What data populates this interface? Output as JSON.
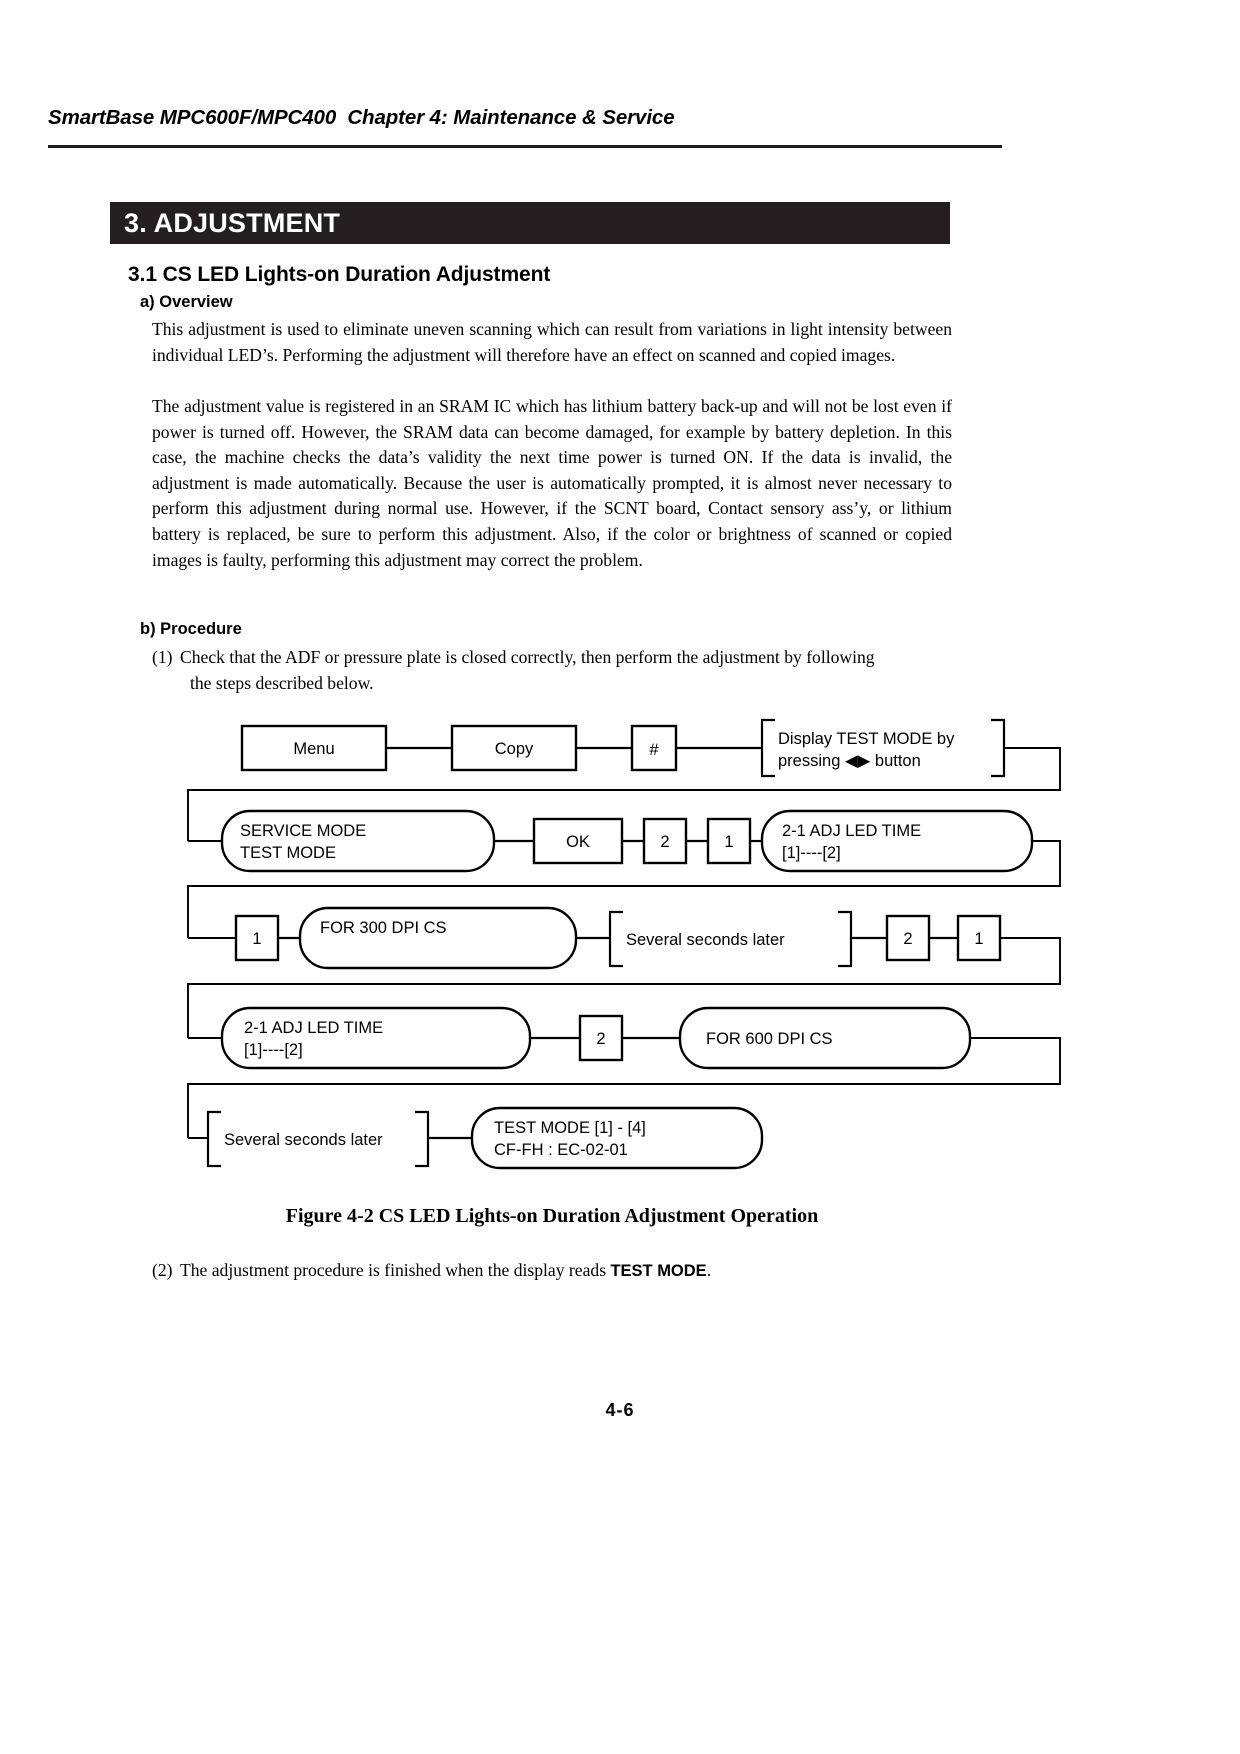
{
  "header": {
    "running_head": "SmartBase MPC600F/MPC400  Chapter 4: Maintenance & Service"
  },
  "chapter_bar": {
    "label": "3. ADJUSTMENT"
  },
  "headings": {
    "section": "3.1 CS LED Lights-on Duration Adjustment",
    "overview": "a) Overview",
    "procedure": "b) Procedure"
  },
  "body": {
    "overview_para_1": "This adjustment is used to eliminate uneven scanning which can result from variations in light intensity between individual LED’s.  Performing the adjustment will therefore have an effect on scanned and copied images.",
    "overview_para_2": "The adjustment value is registered in an SRAM IC which has lithium battery back-up and will not be lost even if power is turned off.  However, the SRAM data can become damaged, for example by battery depletion.  In this case, the machine checks the data’s validity the next time power is turned ON.  If the data is invalid, the adjustment is made automatically. Because the user is automatically prompted, it is almost never necessary to perform this adjustment during normal use.  However, if the SCNT board, Contact sensory ass’y, or lithium battery is replaced, be sure to perform this adjustment.  Also, if the color or brightness of scanned or copied images is faulty, performing this adjustment may correct the problem.",
    "step_1_num": "(1)",
    "step_1_text": "Check that the ADF or pressure plate is closed correctly, then perform the adjustment by following",
    "step_1_cont": "the steps described below.",
    "step_2_num": "(2)",
    "step_2_text_before": "The adjustment procedure is finished when the display reads ",
    "step_2_emphasis": "TEST MODE",
    "step_2_text_after": "."
  },
  "figure": {
    "caption": "Figure 4-2 CS LED Lights-on Duration Adjustment Operation"
  },
  "footer": {
    "page_number": "4-6"
  },
  "flowchart": {
    "row1": {
      "menu": "Menu",
      "copy": "Copy",
      "hash": "#",
      "note_line1": "Display TEST MODE by",
      "note_line2": "pressing ◀▶ button"
    },
    "row2": {
      "display_line1": "SERVICE MODE",
      "display_line2": "TEST MODE",
      "ok": "OK",
      "key2": "2",
      "key1": "1",
      "result_line1": "2-1 ADJ LED TIME",
      "result_line2": "[1]----[2]"
    },
    "row3": {
      "key1": "1",
      "display": "FOR 300 DPI CS",
      "note": "Several seconds later",
      "key2": "2",
      "key1b": "1"
    },
    "row4": {
      "display_line1": "2-1 ADJ LED TIME",
      "display_line2": "[1]----[2]",
      "key2": "2",
      "display2": "FOR 600 DPI CS"
    },
    "row5": {
      "note": "Several seconds later",
      "display_line1": "TEST MODE [1] - [4]",
      "display_line2": "CF-FH : EC-02-01"
    }
  }
}
